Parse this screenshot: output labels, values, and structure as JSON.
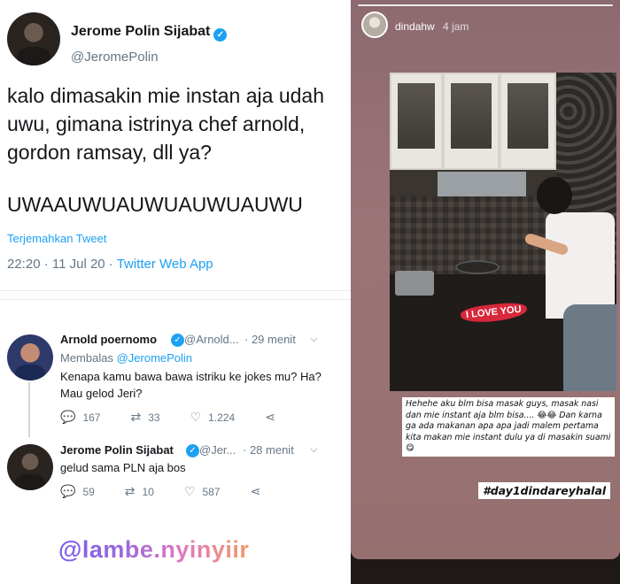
{
  "tweet": {
    "author_name": "Jerome Polin Sijabat",
    "author_handle": "@JeromePolin",
    "text": "kalo dimasakin mie instan aja udah uwu, gimana istrinya chef arnold, gordon ramsay, dll ya?",
    "shout": "UWAAUWUAUWUAUWUAUWU",
    "translate_label": "Terjemahkan Tweet",
    "timestamp": "22:20 · 11 Jul 20 · ",
    "source": "Twitter Web App"
  },
  "replies": [
    {
      "name": "Arnold poernomo",
      "handle": "@Arnold...",
      "time": "· 29 menit",
      "replying_prefix": "Membalas ",
      "replying_handle": "@JeromePolin",
      "text": "Kenapa kamu bawa bawa istriku ke jokes mu? Ha? Mau gelod Jeri?",
      "replies": "167",
      "retweets": "33",
      "likes": "1.224"
    },
    {
      "name": "Jerome Polin Sijabat",
      "handle": "@Jer...",
      "time": "· 28 menit",
      "text": "gelud sama PLN aja bos",
      "replies": "59",
      "retweets": "10",
      "likes": "587"
    }
  ],
  "watermark": "@lambe.nyinyiir",
  "story": {
    "username": "dindahw",
    "time": "4 jam",
    "sticker": "I LOVE YOU",
    "caption": "Hehehe aku blm bisa masak guys, masak nasi dan mie instant aja blm bisa.... 😂😂 Dan karna ga ada makanan apa apa jadi malem pertama kita makan mie instant dulu ya di masakin suami 😋",
    "hashtag": "#day1dindareyhalal"
  },
  "icons": {
    "verified": "verified-check",
    "chevron": "chevron-down",
    "reply": "reply-bubble",
    "retweet": "retweet-arrows",
    "like": "heart",
    "share": "share-nodes"
  },
  "colors": {
    "twitter_blue": "#1da1f2",
    "muted": "#657786",
    "story_bg": "#9b7478"
  }
}
